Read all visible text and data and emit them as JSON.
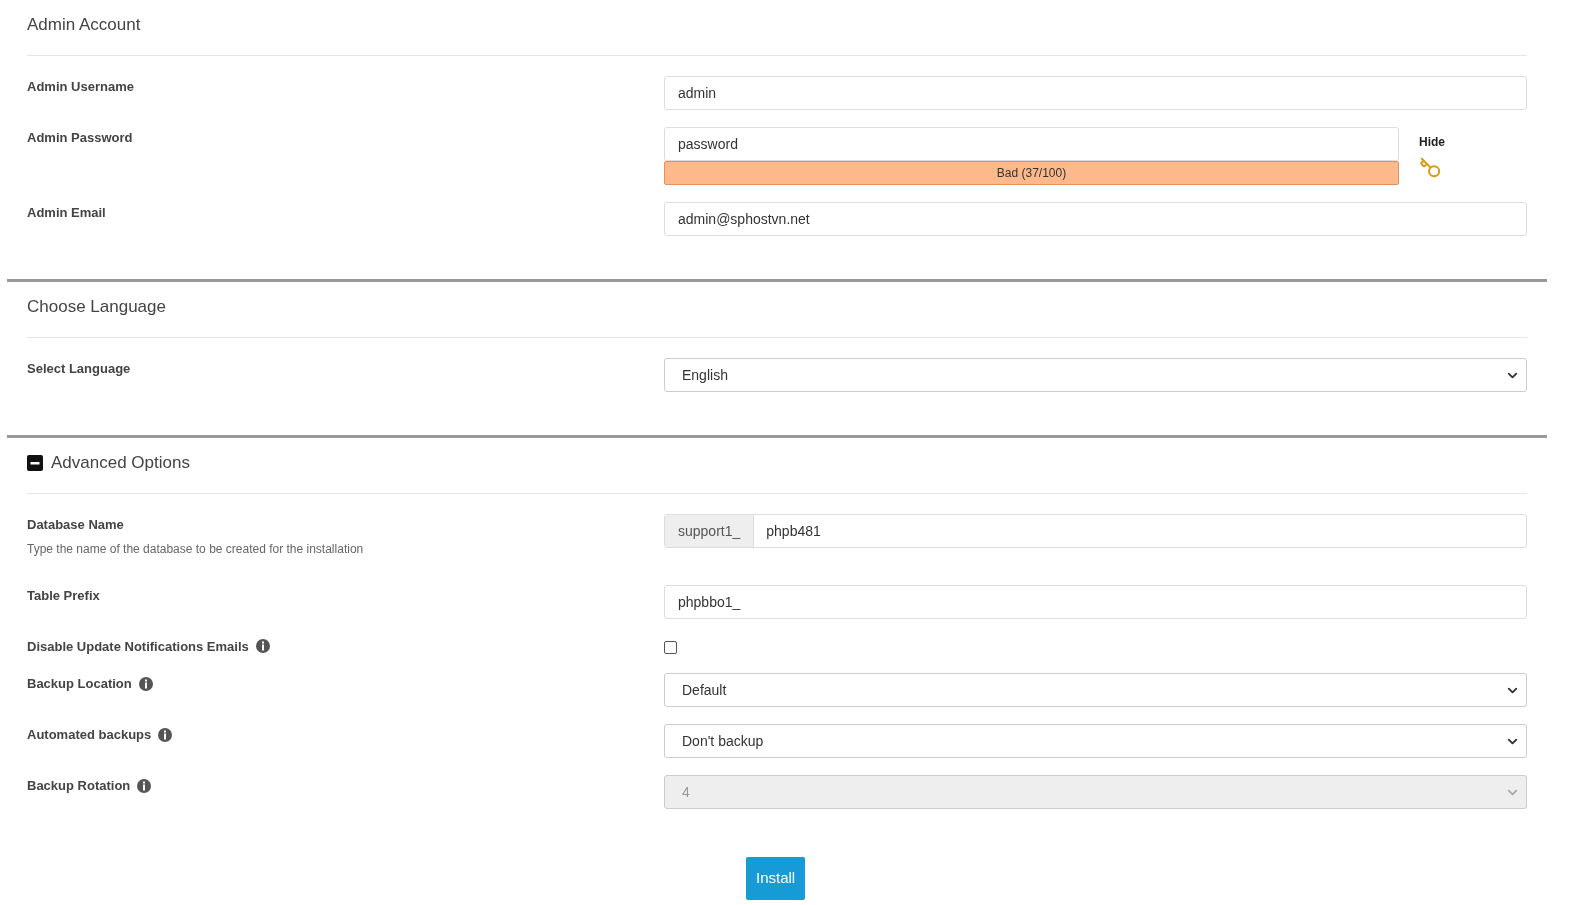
{
  "sections": [
    {
      "title": "Admin Account",
      "fields": [
        {
          "kind": "text",
          "label": "Admin Username",
          "value": "admin"
        },
        {
          "kind": "password",
          "label": "Admin Password",
          "value": "password",
          "strength": "Bad (37/100)",
          "toggle": "Hide"
        },
        {
          "kind": "text",
          "label": "Admin Email",
          "value": "admin@sphostvn.net"
        }
      ]
    },
    {
      "title": "Choose Language",
      "fields": [
        {
          "kind": "select",
          "label": "Select Language",
          "value": "English",
          "info": false,
          "disabled": false
        }
      ]
    },
    {
      "title": "Advanced Options",
      "expanded": true,
      "fields": [
        {
          "kind": "prefixed",
          "label": "Database Name",
          "description": "Type the name of the database to be created for the installation",
          "prefix": "support1_",
          "value": "phpb481"
        },
        {
          "kind": "text",
          "label": "Table Prefix",
          "value": "phpbbo1_"
        },
        {
          "kind": "checkbox",
          "label": "Disable Update Notifications Emails",
          "info": true,
          "checked": false
        },
        {
          "kind": "select",
          "label": "Backup Location",
          "value": "Default",
          "info": true,
          "disabled": false
        },
        {
          "kind": "select",
          "label": "Automated backups",
          "value": "Don't backup",
          "info": true,
          "disabled": false
        },
        {
          "kind": "select",
          "label": "Backup Rotation",
          "value": "4",
          "info": true,
          "disabled": true
        }
      ]
    }
  ],
  "install_button": "Install"
}
